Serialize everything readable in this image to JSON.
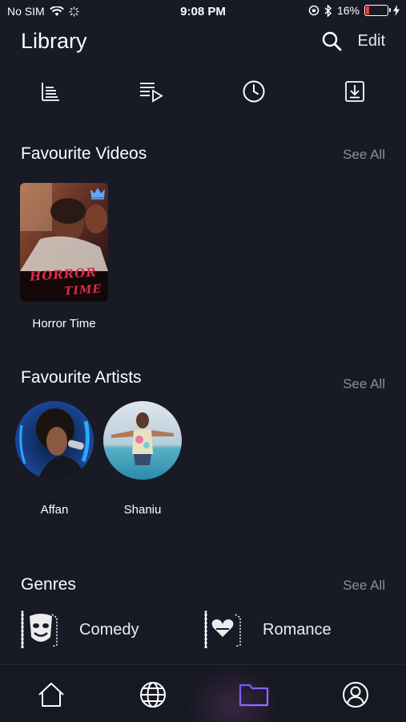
{
  "status_bar": {
    "carrier": "No SIM",
    "time": "9:08 PM",
    "battery_percent": "16%",
    "battery_level": 0.16,
    "battery_color": "#ff3b30"
  },
  "header": {
    "title": "Library",
    "edit_label": "Edit"
  },
  "tabs": [
    {
      "icon": "list-icon"
    },
    {
      "icon": "playlist-play-icon"
    },
    {
      "icon": "clock-icon"
    },
    {
      "icon": "download-icon"
    }
  ],
  "favourite_videos": {
    "title": "Favourite Videos",
    "see_all": "See All",
    "items": [
      {
        "label": "Horror Time",
        "poster_text_1": "HORROR",
        "poster_text_2": "TIME",
        "badge_icon": "crown-icon"
      }
    ]
  },
  "favourite_artists": {
    "title": "Favourite Artists",
    "see_all": "See All",
    "items": [
      {
        "name": "Affan"
      },
      {
        "name": "Shaniu"
      }
    ]
  },
  "genres": {
    "title": "Genres",
    "see_all": "See All",
    "items": [
      {
        "label": "Comedy"
      },
      {
        "label": "Romance"
      }
    ]
  },
  "bottom_nav": {
    "items": [
      {
        "icon": "home-icon"
      },
      {
        "icon": "globe-icon"
      },
      {
        "icon": "folder-icon",
        "active": true
      },
      {
        "icon": "profile-icon"
      }
    ],
    "active_color": "#7b6cff"
  }
}
